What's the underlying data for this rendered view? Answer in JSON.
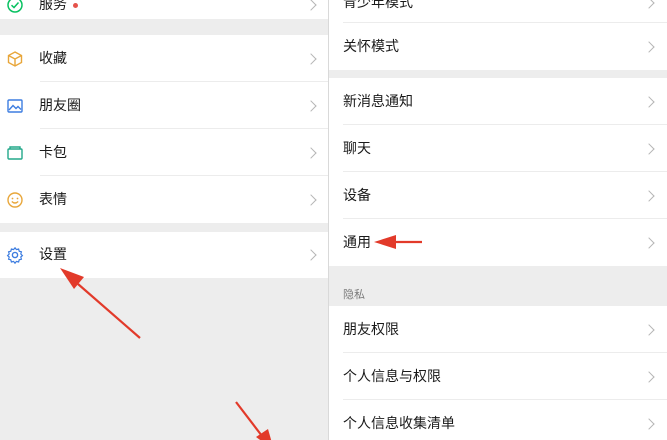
{
  "left_menu": {
    "items": [
      {
        "label": "服务",
        "icon": "wechat-pay-icon",
        "badge": true
      },
      {
        "label": "收藏",
        "icon": "cube-icon"
      },
      {
        "label": "朋友圈",
        "icon": "photo-icon"
      },
      {
        "label": "卡包",
        "icon": "wallet-icon"
      },
      {
        "label": "表情",
        "icon": "smiley-icon"
      },
      {
        "label": "设置",
        "icon": "gear-icon"
      }
    ]
  },
  "right_menu": {
    "items": [
      {
        "label": "青少年模式"
      },
      {
        "label": "关怀模式"
      },
      {
        "label": "新消息通知"
      },
      {
        "label": "聊天"
      },
      {
        "label": "设备"
      },
      {
        "label": "通用"
      },
      {
        "label": "朋友权限"
      },
      {
        "label": "个人信息与权限"
      },
      {
        "label": "个人信息收集清单"
      }
    ],
    "section_privacy": "隐私"
  },
  "colors": {
    "accent_green": "#07c160",
    "annotation_red": "#e23a2a",
    "badge_red": "#e5534b"
  }
}
